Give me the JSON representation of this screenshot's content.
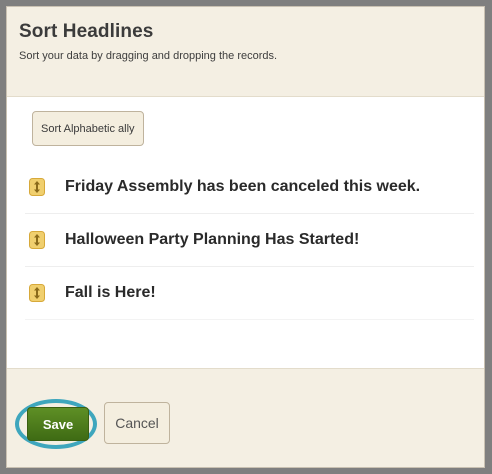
{
  "dialog": {
    "title": "Sort Headlines",
    "subtitle": "Sort your data by dragging and dropping the records."
  },
  "toolbar": {
    "sort_alpha_label": "Sort Alphabetic ally"
  },
  "records": [
    {
      "label": "Friday Assembly has been canceled this week.",
      "icon": "drag-handle-icon"
    },
    {
      "label": "Halloween Party Planning Has Started!",
      "icon": "drag-handle-icon"
    },
    {
      "label": "Fall is Here!",
      "icon": "drag-handle-icon"
    }
  ],
  "footer": {
    "save_label": "Save",
    "cancel_label": "Cancel"
  },
  "colors": {
    "header_bg": "#f4efe3",
    "save_button": "#4a7a1a",
    "highlight_ring": "#3ea6bd",
    "drag_icon": "#e8c25a"
  }
}
